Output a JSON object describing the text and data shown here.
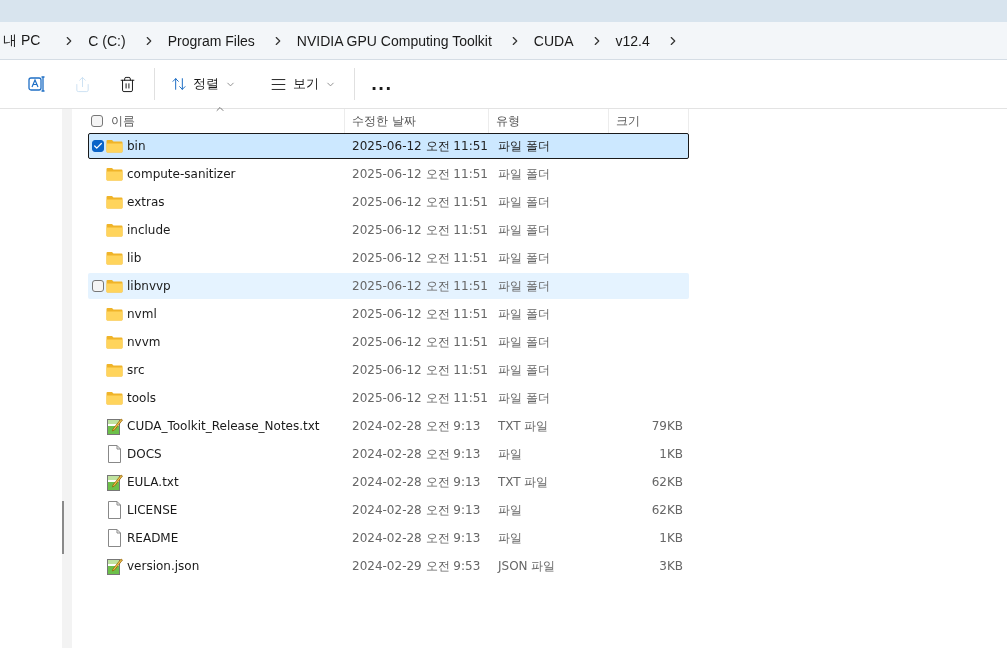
{
  "breadcrumb": [
    "내 PC",
    "C (C:)",
    "Program Files",
    "NVIDIA GPU Computing Toolkit",
    "CUDA",
    "v12.4"
  ],
  "toolbar": [
    {
      "kind": "rename",
      "disabled": false
    },
    {
      "kind": "share",
      "disabled": true
    },
    {
      "kind": "delete",
      "disabled": false
    },
    {
      "kind": "sort",
      "label": "정렬",
      "disabled": false
    },
    {
      "kind": "view",
      "label": "보기",
      "disabled": false
    },
    {
      "kind": "more",
      "label": "...",
      "disabled": false
    }
  ],
  "select_all": {
    "checked": false
  },
  "columns": [
    "이름",
    "수정한 날짜",
    "유형",
    "크기"
  ],
  "files": [
    {
      "kind": "folder",
      "name": "bin",
      "date": "2025-06-12 오전 11:51",
      "type": "파일 폴더",
      "selected": true,
      "hovered": false
    },
    {
      "kind": "folder",
      "name": "compute-sanitizer",
      "date": "2025-06-12 오전 11:51",
      "type": "파일 폴더",
      "selected": false,
      "hovered": false
    },
    {
      "kind": "folder",
      "name": "extras",
      "date": "2025-06-12 오전 11:51",
      "type": "파일 폴더",
      "selected": false,
      "hovered": false
    },
    {
      "kind": "folder",
      "name": "include",
      "date": "2025-06-12 오전 11:51",
      "type": "파일 폴더",
      "selected": false,
      "hovered": false
    },
    {
      "kind": "folder",
      "name": "lib",
      "date": "2025-06-12 오전 11:51",
      "type": "파일 폴더",
      "selected": false,
      "hovered": false
    },
    {
      "kind": "folder",
      "name": "libnvvp",
      "date": "2025-06-12 오전 11:51",
      "type": "파일 폴더",
      "selected": false,
      "hovered": true
    },
    {
      "kind": "folder",
      "name": "nvml",
      "date": "2025-06-12 오전 11:51",
      "type": "파일 폴더",
      "selected": false,
      "hovered": false
    },
    {
      "kind": "folder",
      "name": "nvvm",
      "date": "2025-06-12 오전 11:51",
      "type": "파일 폴더",
      "selected": false,
      "hovered": false
    },
    {
      "kind": "folder",
      "name": "src",
      "date": "2025-06-12 오전 11:51",
      "type": "파일 폴더",
      "selected": false,
      "hovered": false
    },
    {
      "kind": "folder",
      "name": "tools",
      "date": "2025-06-12 오전 11:51",
      "type": "파일 폴더",
      "selected": false,
      "hovered": false
    },
    {
      "kind": "text",
      "name": "CUDA_Toolkit_Release_Notes.txt",
      "date": "2024-02-28 오전 9:13",
      "type": "TXT 파일",
      "size": "79KB",
      "selected": false,
      "hovered": false
    },
    {
      "kind": "file",
      "name": "DOCS",
      "date": "2024-02-28 오전 9:13",
      "type": "파일",
      "size": "1KB",
      "selected": false,
      "hovered": false
    },
    {
      "kind": "text",
      "name": "EULA.txt",
      "date": "2024-02-28 오전 9:13",
      "type": "TXT 파일",
      "size": "62KB",
      "selected": false,
      "hovered": false
    },
    {
      "kind": "file",
      "name": "LICENSE",
      "date": "2024-02-28 오전 9:13",
      "type": "파일",
      "size": "62KB",
      "selected": false,
      "hovered": false
    },
    {
      "kind": "file",
      "name": "README",
      "date": "2024-02-28 오전 9:13",
      "type": "파일",
      "size": "1KB",
      "selected": false,
      "hovered": false
    },
    {
      "kind": "text",
      "name": "version.json",
      "date": "2024-02-29 오전 9:53",
      "type": "JSON 파일",
      "size": "3KB",
      "selected": false,
      "hovered": false
    }
  ]
}
